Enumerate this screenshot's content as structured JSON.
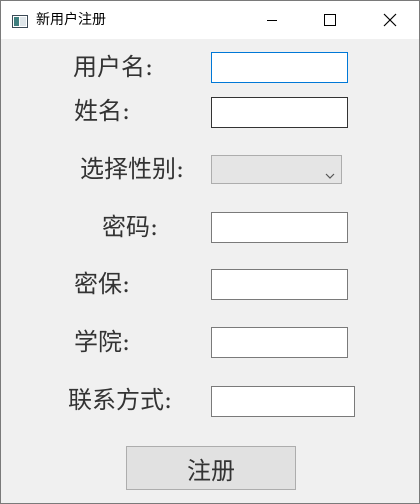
{
  "window": {
    "title": "新用户注册",
    "icon": "window-app-icon",
    "controls": [
      "minimize-icon",
      "maximize-icon",
      "close-icon"
    ]
  },
  "form": {
    "username_label": "用户名:",
    "realname_label": "姓名:",
    "gender_label": "选择性别:",
    "gender_value": "",
    "password_label": "密码:",
    "security_label": "密保:",
    "college_label": "学院:",
    "contact_label": "联系方式:",
    "submit_label": "注册"
  },
  "colors": {
    "focus_border": "#0078d7",
    "window_bg": "#f0f0f0",
    "label_text": "#333333"
  }
}
